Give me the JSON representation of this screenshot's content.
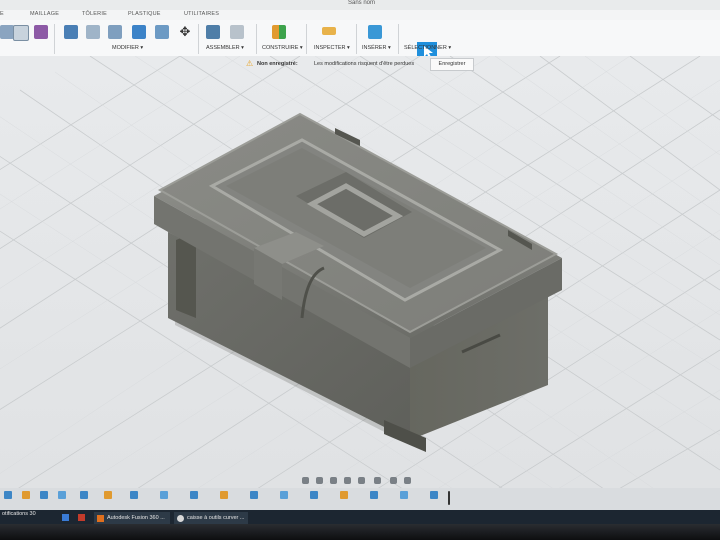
{
  "window": {
    "title": "Sans nom"
  },
  "ribbon_tabs": [
    "MAILLAGE",
    "TÔLERIE",
    "PLASTIQUE",
    "UTILITAIRES"
  ],
  "tool_groups": [
    "MODIFIER ▾",
    "ASSEMBLER ▾",
    "CONSTRUIRE ▾",
    "INSPECTER ▾",
    "INSÉRER ▾",
    "SÉLECTIONNER ▾"
  ],
  "notice": {
    "title": "Non enregistré:",
    "message": "Les modifications risquent d'être perdues",
    "button": "Enregistrer"
  },
  "left_button": "«",
  "taskbar": {
    "items": [
      "otifications 30",
      "Autodesk Fusion 360 ...",
      "caisse à outils curver ..."
    ]
  },
  "colors": {
    "select_tool": "#1f8fdc",
    "viewport_bg": "#e4e6e8",
    "model_body": "#7a7b75",
    "taskbar": "#1c2631"
  },
  "icons": [
    "warning-icon",
    "select-cursor-icon",
    "move-icon",
    "orbit-icon",
    "pan-icon",
    "zoom-icon",
    "display-icon",
    "grid-icon"
  ]
}
